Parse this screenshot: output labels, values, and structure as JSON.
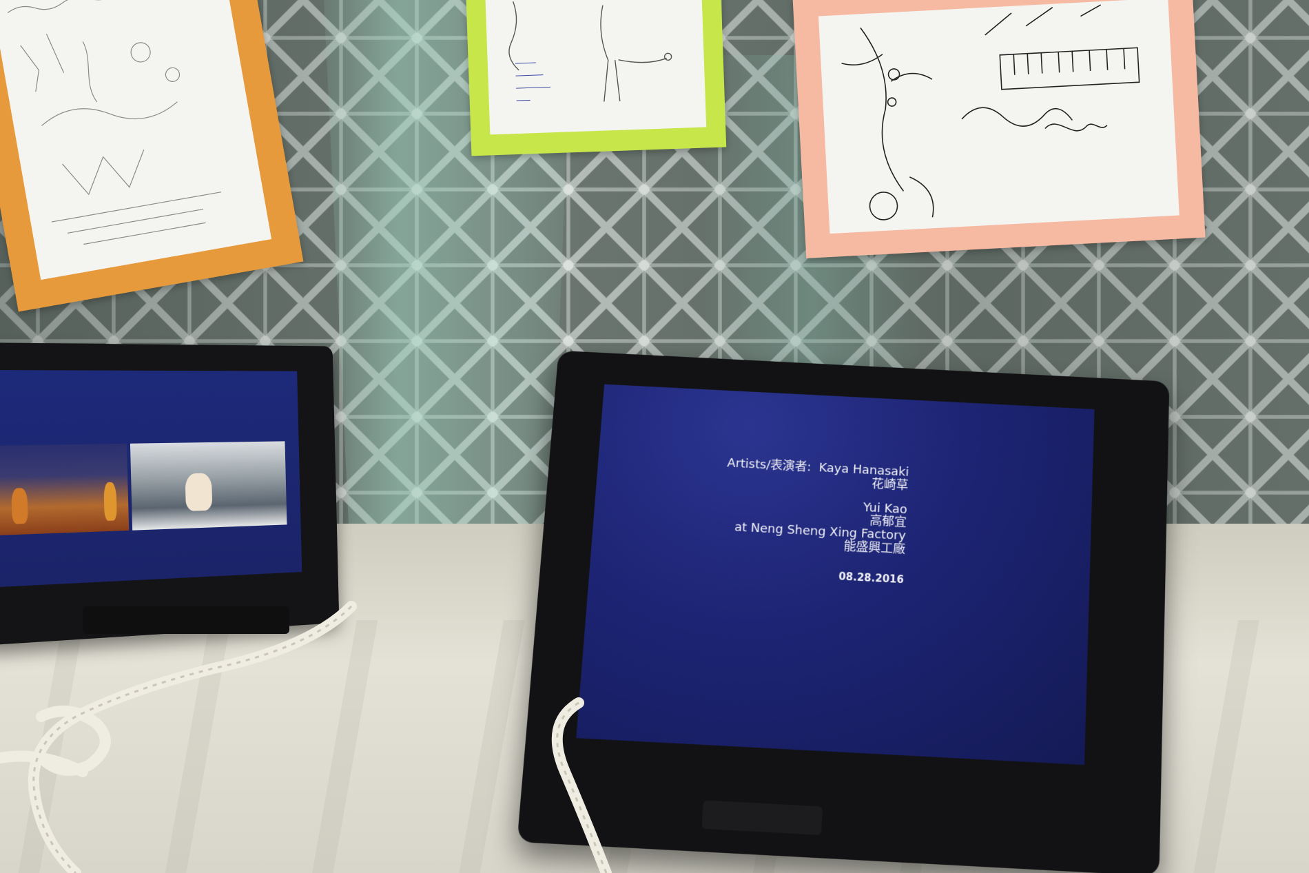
{
  "left_tablet": {
    "screen": "video-still"
  },
  "right_tablet": {
    "credits": {
      "artists_label": "Artists/表演者:",
      "artist_1_name": "Kaya Hanasaki",
      "artist_1_chinese": "花崎草",
      "artist_2_name": "Yui Kao",
      "artist_2_chinese": "高郁宜",
      "venue": "at  Neng Sheng Xing Factory",
      "venue_chinese": "能盛興工廠",
      "date": "08.28.2016"
    }
  },
  "colors": {
    "screen_blue": "#1d2474",
    "orange_frame": "#e79a3b",
    "green_frame": "#c6e64a",
    "pink_frame": "#f6b9a2",
    "tablecloth": "#e4e2d6"
  }
}
